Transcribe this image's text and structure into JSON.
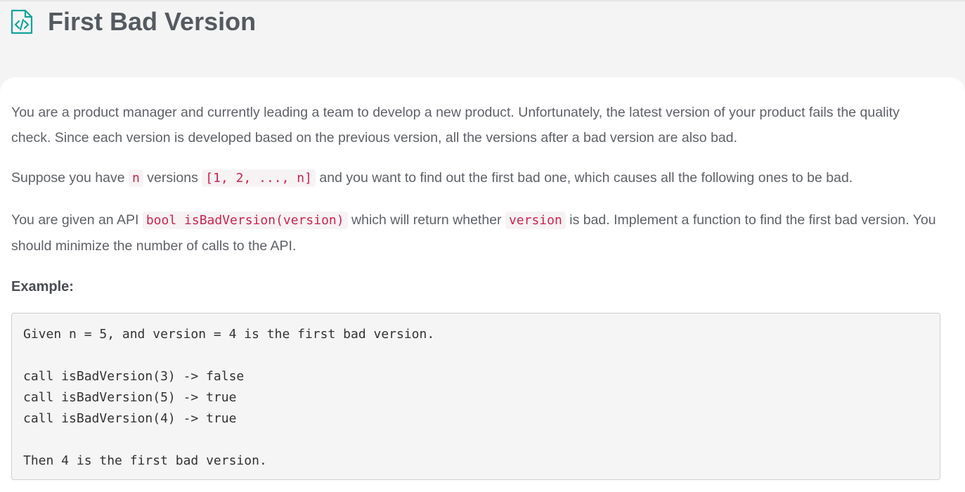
{
  "header": {
    "title": "First Bad Version",
    "icon": "code-file-icon",
    "accent_color": "#13a39a"
  },
  "description": {
    "p1": "You are a product manager and currently leading a team to develop a new product. Unfortunately, the latest version of your product fails the quality check. Since each version is developed based on the previous version, all the versions after a bad version are also bad.",
    "p2_a": "Suppose you have ",
    "p2_code1": "n",
    "p2_b": " versions ",
    "p2_code2": "[1, 2, ..., n]",
    "p2_c": " and you want to find out the first bad one, which causes all the following ones to be bad.",
    "p3_a": "You are given an API ",
    "p3_code1": "bool isBadVersion(version)",
    "p3_b": " which will return whether ",
    "p3_code2": "version",
    "p3_c": " is bad. Implement a function to find the first bad version. You should minimize the number of calls to the API."
  },
  "example": {
    "heading": "Example:",
    "lines": [
      "Given n = 5, and version = 4 is the first bad version.",
      "call isBadVersion(3) -> false",
      "call isBadVersion(5) -> true",
      "call isBadVersion(4) -> true",
      "Then 4 is the first bad version."
    ]
  }
}
